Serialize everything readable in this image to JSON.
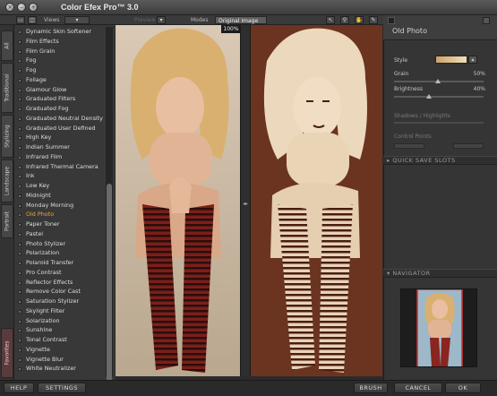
{
  "window": {
    "title": "Color Efex Pro™ 3.0"
  },
  "toolbar": {
    "views_label": "Views",
    "preview_label": "Preview",
    "modes_label": "Modes",
    "mode_value": "Original Image",
    "zoom": "100%"
  },
  "tabs": [
    "All",
    "Traditional",
    "Stylizing",
    "Landscape",
    "Portrait",
    "Favorites"
  ],
  "filters": {
    "items": [
      "Dynamic Skin Softener",
      "Film Effects",
      "Film Grain",
      "Fog",
      "Fog",
      "Foliage",
      "Glamour Glow",
      "Graduated Filters",
      "Graduated Fog",
      "Graduated Neutral Density",
      "Graduated User Defined",
      "High Key",
      "Indian Summer",
      "Infrared Film",
      "Infrared Thermal Camera",
      "Ink",
      "Low Key",
      "Midnight",
      "Monday Morning",
      "Old Photo",
      "Paper Toner",
      "Pastel",
      "Photo Stylizer",
      "Polarization",
      "Polaroid Transfer",
      "Pro Contrast",
      "Reflector Effects",
      "Remove Color Cast",
      "Saturation Stylizer",
      "Skylight Filter",
      "Solarization",
      "Sunshine",
      "Tonal Contrast",
      "Vignette",
      "Vignette Blur",
      "White Neutralizer"
    ],
    "selected": "Old Photo"
  },
  "panel": {
    "title": "Old Photo",
    "style_label": "Style",
    "grain_label": "Grain",
    "grain_value": "50%",
    "brightness_label": "Brightness",
    "brightness_value": "40%",
    "shadows_label": "Shadows / Highlights",
    "control_points_label": "Control Points",
    "quick_save_label": "QUICK SAVE SLOTS",
    "navigator_label": "NAVIGATOR"
  },
  "bottom": {
    "help": "HELP",
    "settings": "SETTINGS",
    "brush": "BRUSH",
    "cancel": "CANCEL",
    "ok": "OK"
  },
  "colors": {
    "accent": "#f0a23a",
    "sepia": "#6b3420"
  }
}
